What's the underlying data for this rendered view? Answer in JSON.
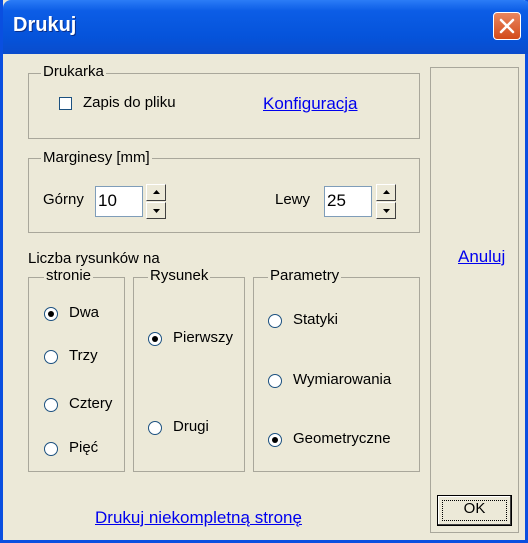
{
  "window": {
    "title": "Drukuj"
  },
  "printer": {
    "legend": "Drukarka",
    "save_to_file": {
      "label": "Zapis do pliku",
      "checked": false
    },
    "config_link": "Konfiguracja"
  },
  "margins": {
    "legend": "Marginesy [mm]",
    "top": {
      "label": "Górny",
      "value": "10"
    },
    "left": {
      "label": "Lewy",
      "value": "25"
    }
  },
  "count": {
    "heading": "Liczba rysunków na",
    "legend": "stronie",
    "options": [
      {
        "label": "Dwa",
        "selected": true
      },
      {
        "label": "Trzy",
        "selected": false
      },
      {
        "label": "Cztery",
        "selected": false
      },
      {
        "label": "Pięć",
        "selected": false
      }
    ]
  },
  "drawing": {
    "legend": "Rysunek",
    "options": [
      {
        "label": "Pierwszy",
        "selected": true
      },
      {
        "label": "Drugi",
        "selected": false
      }
    ]
  },
  "params": {
    "legend": "Parametry",
    "options": [
      {
        "label": "Statyki",
        "selected": false
      },
      {
        "label": "Wymiarowania",
        "selected": false
      },
      {
        "label": "Geometryczne",
        "selected": true
      }
    ]
  },
  "actions": {
    "print_incomplete": "Drukuj niekompletną stronę",
    "cancel": "Anuluj",
    "ok": "OK"
  }
}
